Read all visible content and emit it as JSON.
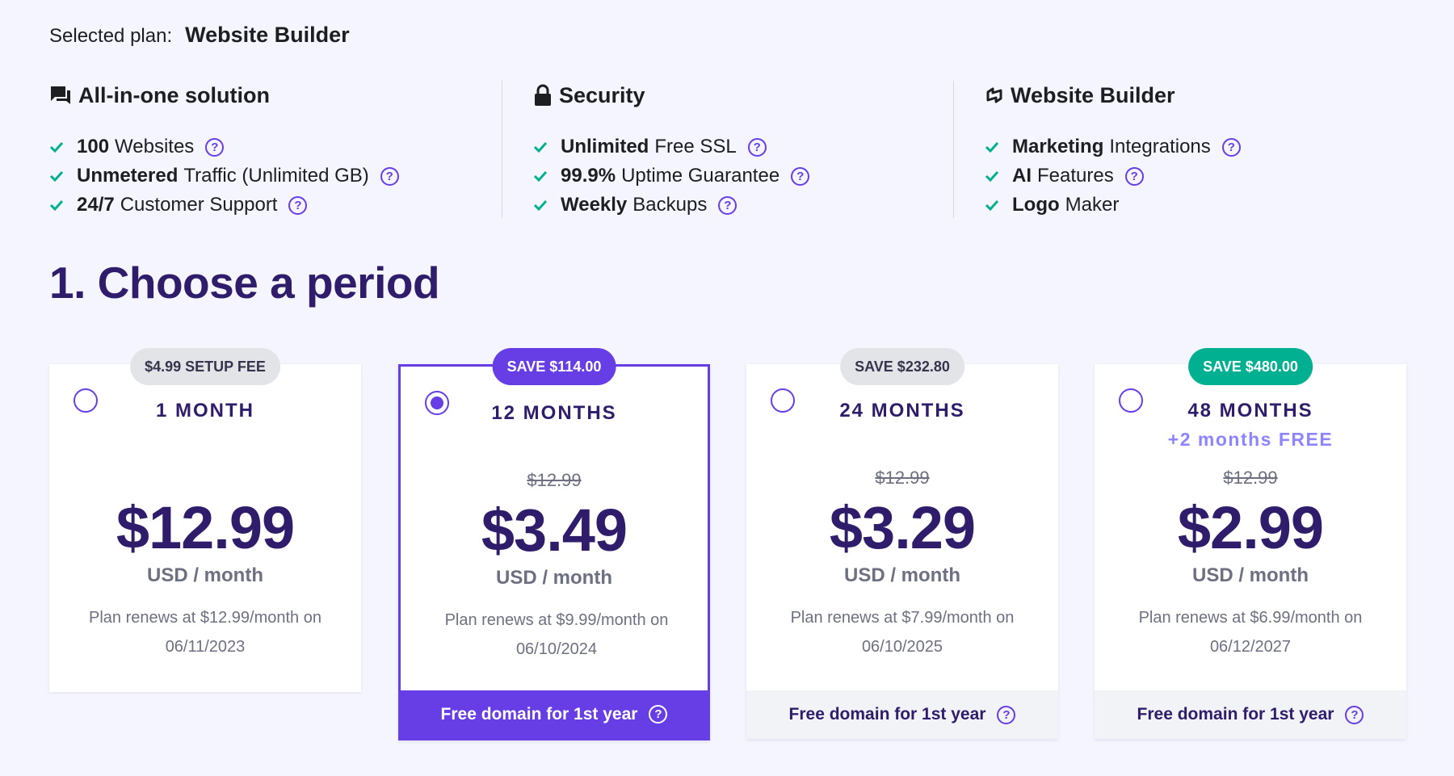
{
  "selected_plan": {
    "label": "Selected plan:",
    "name": "Website Builder"
  },
  "features": [
    {
      "heading": "All-in-one solution",
      "icon": "chat-icon",
      "items": [
        {
          "bold": "100",
          "text": "Websites",
          "help": true
        },
        {
          "bold": "Unmetered",
          "text": "Traffic (Unlimited GB)",
          "help": true
        },
        {
          "bold": "24/7",
          "text": "Customer Support",
          "help": true
        }
      ]
    },
    {
      "heading": "Security",
      "icon": "lock-icon",
      "items": [
        {
          "bold": "Unlimited",
          "text": "Free SSL",
          "help": true
        },
        {
          "bold": "99.9%",
          "text": "Uptime Guarantee",
          "help": true
        },
        {
          "bold": "Weekly",
          "text": "Backups",
          "help": true
        }
      ]
    },
    {
      "heading": "Website Builder",
      "icon": "builder-icon",
      "items": [
        {
          "bold": "Marketing",
          "text": "Integrations",
          "help": true
        },
        {
          "bold": "AI",
          "text": "Features",
          "help": true
        },
        {
          "bold": "Logo",
          "text": "Maker",
          "help": false
        }
      ]
    }
  ],
  "section_title": "1. Choose a period",
  "plans": [
    {
      "badge": "$4.99 SETUP FEE",
      "badge_style": "gray",
      "period": "1 MONTH",
      "bonus": "",
      "old_price": "",
      "price": "$12.99",
      "unit": "USD / month",
      "renew_line1": "Plan renews at $12.99/month on",
      "renew_line2": "06/11/2023",
      "footer": "",
      "selected": false
    },
    {
      "badge": "SAVE $114.00",
      "badge_style": "purple",
      "period": "12 MONTHS",
      "bonus": "",
      "old_price": "$12.99",
      "price": "$3.49",
      "unit": "USD / month",
      "renew_line1": "Plan renews at $9.99/month on",
      "renew_line2": "06/10/2024",
      "footer": "Free domain for 1st year",
      "selected": true
    },
    {
      "badge": "SAVE $232.80",
      "badge_style": "gray",
      "period": "24 MONTHS",
      "bonus": "",
      "old_price": "$12.99",
      "price": "$3.29",
      "unit": "USD / month",
      "renew_line1": "Plan renews at $7.99/month on",
      "renew_line2": "06/10/2025",
      "footer": "Free domain for 1st year",
      "selected": false
    },
    {
      "badge": "SAVE $480.00",
      "badge_style": "green",
      "period": "48 MONTHS",
      "bonus": "+2 months FREE",
      "old_price": "$12.99",
      "price": "$2.99",
      "unit": "USD / month",
      "renew_line1": "Plan renews at $6.99/month on",
      "renew_line2": "06/12/2027",
      "footer": "Free domain for 1st year",
      "selected": false
    }
  ],
  "colors": {
    "accent": "#673de6",
    "heading": "#2f1c6a",
    "check": "#00b090",
    "save_green": "#00b090",
    "bonus": "#8c85ff"
  }
}
